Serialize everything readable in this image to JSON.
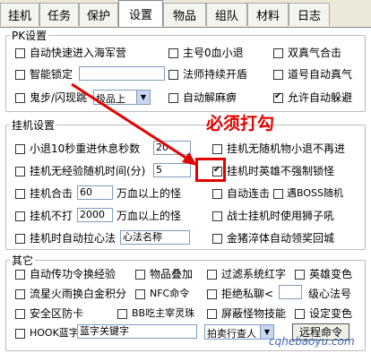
{
  "tabs": [
    "挂机",
    "任务",
    "保护",
    "设置",
    "物品",
    "组队",
    "材料",
    "日志"
  ],
  "active_tab": "设置",
  "pk": {
    "title": "PK设置",
    "auto_enter_navy": "自动快速进入海军营",
    "main_hp0_retreat": "主号0血小退",
    "double_true_qi": "双真气合击",
    "smart_lock": "智能锁定",
    "taoist_auto_on": "法师持续开盾",
    "taoist_auto_qi": "道号自动真气",
    "ghost_step": "鬼步/闪现跳",
    "ghost_target": "极品上",
    "auto_detox": "自动解麻痹",
    "allow_auto_dodge": "允许自动躲避"
  },
  "guaji": {
    "title": "挂机设置",
    "small_retreat_rest": "小退10秒重进休息秒数",
    "small_retreat_value": "20",
    "no_monster_no_reenter": "挂机无随机物小退不再进",
    "no_exp_random_time": "挂机无经验随机时间(分)",
    "no_exp_value": "5",
    "hero_no_lock_monster": "挂机时英雄不强制锁怪",
    "combo": "挂机合击",
    "combo_value": "60",
    "combo_suffix": "万血以上的怪",
    "auto_chain": "自动连击",
    "boss_random": "遇BOSS随机",
    "not_hit": "挂机不打",
    "not_hit_value": "2000",
    "not_hit_suffix": "万血以上的怪",
    "warrior_lion": "战士挂机时使用狮子吼",
    "auto_pull_magic": "挂机时自动拉心法",
    "magic_name": "心法名称",
    "golden_body": "金猪淬体自动领奖回城"
  },
  "other": {
    "title": "其它",
    "auto_transfer_exp": "自动传功令换经验",
    "item_stack": "物品叠加",
    "filter_system_text": "过滤系统红字",
    "hero_color": "英雄变色",
    "meteor_gold_points": "流星火雨换白金积分",
    "npc_cmd": "NFC命令",
    "reject_private": "拒绝私聊<",
    "level_alt": "级心法号",
    "safe_zone_card": "安全区防卡",
    "bb_eat_soul": "BB吃主宰灵珠",
    "block_special": "屏蔽怪物技能",
    "alt_color": "设定变色",
    "hook_blue": "HOOK蓝字",
    "blue_keywords": "蓝字关键字",
    "auction_query": "拍卖行查人",
    "remote_cmd": "远程命令"
  },
  "annotation": "必须打勾",
  "watermark": "cqhebaoyu.com"
}
